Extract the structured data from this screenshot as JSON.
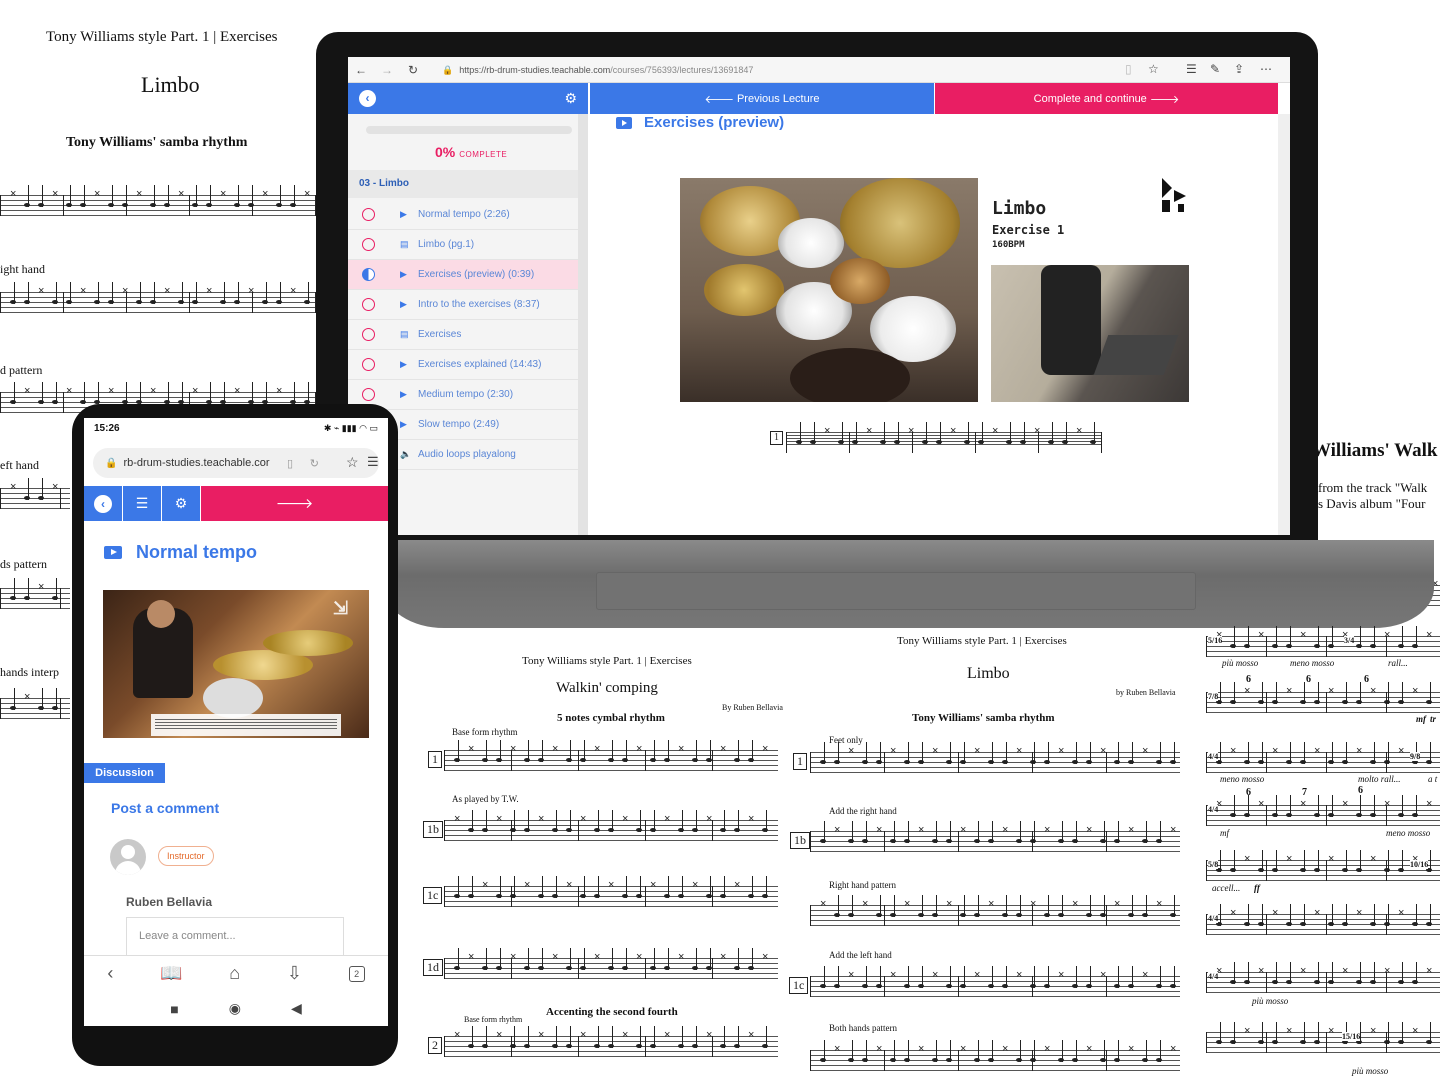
{
  "left_sheet": {
    "header": "Tony Williams style Part. 1 | Exercises",
    "title": "Limbo",
    "subtitle": "Tony Williams' samba rhythm",
    "labels": [
      "ight hand",
      "d pattern",
      "eft hand",
      "ds pattern",
      "hands interp"
    ]
  },
  "right_edge_sheet": {
    "title": "Williams' Walk",
    "line1": "from the track \"Walk",
    "line2": "s Davis album \"Four"
  },
  "browser": {
    "url_domain": "https://rb-drum-studies.teachable.com",
    "url_path": "/courses/756393/lectures/13691847",
    "back_icon": "←",
    "forward_icon": "→",
    "reload_icon": "↻"
  },
  "course": {
    "prev_label": "Previous Lecture",
    "complete_label": "Complete and continue",
    "progress_percent": "0%",
    "progress_word": "COMPLETE",
    "section_title": "03 - Limbo",
    "lectures": [
      {
        "title": "Normal tempo (2:26)",
        "type": "video",
        "status": "empty"
      },
      {
        "title": "Limbo (pg.1)",
        "type": "doc",
        "status": "empty"
      },
      {
        "title": "Exercises (preview) (0:39)",
        "type": "video",
        "status": "half"
      },
      {
        "title": "Intro to the exercises (8:37)",
        "type": "video",
        "status": "empty"
      },
      {
        "title": "Exercises",
        "type": "doc",
        "status": "empty"
      },
      {
        "title": "Exercises explained (14:43)",
        "type": "video",
        "status": "empty"
      },
      {
        "title": "Medium tempo (2:30)",
        "type": "video",
        "status": "empty"
      },
      {
        "title": "Slow tempo (2:49)",
        "type": "video",
        "status": "empty"
      },
      {
        "title": "Audio loops playalong",
        "type": "audio",
        "status": "empty"
      }
    ],
    "lecture_heading": "Exercises (preview)",
    "video_title": "Limbo",
    "video_subtitle": "Exercise 1",
    "video_bpm": "160BPM",
    "exercise_number": "1"
  },
  "phone": {
    "time": "15:26",
    "url": "rb-drum-studies.teachable.cor",
    "lecture_title": "Normal tempo",
    "discussion_label": "Discussion",
    "post_comment_label": "Post a comment",
    "role_badge": "Instructor",
    "author_name": "Ruben Bellavia",
    "comment_placeholder": "Leave a comment...",
    "tab_count": "2"
  },
  "sheet_left": {
    "header": "Tony Williams style Part. 1 | Exercises",
    "title": "Walkin' comping",
    "author": "By Ruben Bellavia",
    "section_title": "5 notes cymbal rhythm",
    "label_base": "Base form rhythm",
    "label_played": "As played by T.W.",
    "label_accent": "Accenting the second fourth",
    "label_base2": "Base form rhythm",
    "nums": [
      "1",
      "1b",
      "1c",
      "1d",
      "2"
    ]
  },
  "sheet_mid": {
    "header": "Tony Williams style Part. 1 | Exercises",
    "title": "Limbo",
    "author": "by Ruben Bellavia",
    "section_title": "Tony Williams' samba rhythm",
    "labels": [
      "Feet only",
      "Add the right hand",
      "Right hand pattern",
      "Add the left hand",
      "Both hands pattern"
    ],
    "nums": [
      "1",
      "1b",
      "1c"
    ]
  },
  "sheet_right": {
    "marks": [
      "più mosso",
      "meno mosso",
      "rall...",
      "meno mosso",
      "molto rall...",
      "mf",
      "meno mosso",
      "accell...",
      "ff",
      "più mosso",
      "più mosso",
      "mf",
      "tr",
      "a t"
    ],
    "tuplets": [
      "6",
      "6",
      "6",
      "6",
      "7",
      "6"
    ],
    "time_sigs": [
      "5/16",
      "3/4",
      "7/8",
      "4/4",
      "9/8",
      "4/4",
      "5/8",
      "10/16",
      "4/4",
      "4/4",
      "15/16"
    ]
  }
}
